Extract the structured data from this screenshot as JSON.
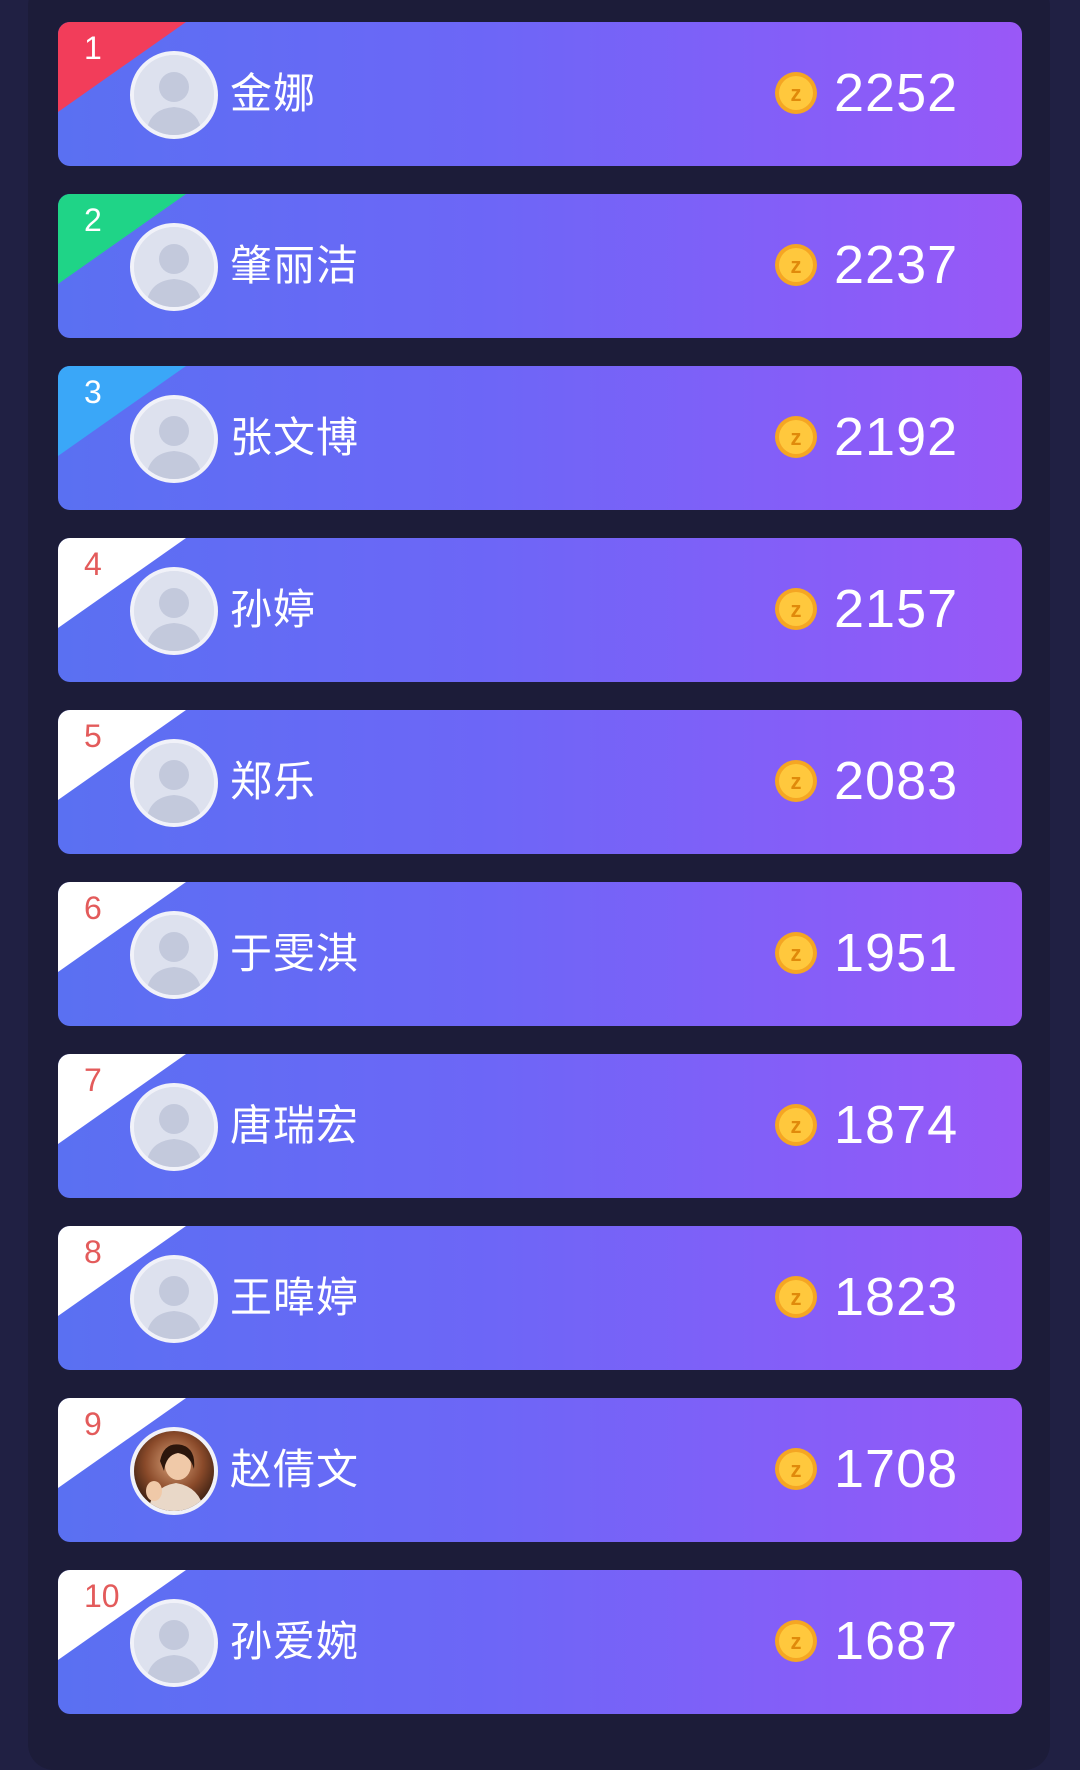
{
  "colors": {
    "background": "#202043",
    "row_gradient_start": "#5a70f2",
    "row_gradient_end": "#9a58f7",
    "rank1": "#f23d5a",
    "rank2": "#1fd487",
    "rank3": "#3aa7f8",
    "rank_other_bg": "#ffffff",
    "rank_other_text": "#e35b5b",
    "coin": "#f7b731"
  },
  "coin_icon": "gold-z-coin-icon",
  "leaderboard": [
    {
      "rank": "1",
      "name": "金娜",
      "score": "2252",
      "avatar": "default-avatar"
    },
    {
      "rank": "2",
      "name": "肇丽洁",
      "score": "2237",
      "avatar": "default-avatar"
    },
    {
      "rank": "3",
      "name": "张文博",
      "score": "2192",
      "avatar": "default-avatar"
    },
    {
      "rank": "4",
      "name": "孙婷",
      "score": "2157",
      "avatar": "default-avatar"
    },
    {
      "rank": "5",
      "name": "郑乐",
      "score": "2083",
      "avatar": "default-avatar"
    },
    {
      "rank": "6",
      "name": "于雯淇",
      "score": "1951",
      "avatar": "default-avatar"
    },
    {
      "rank": "7",
      "name": "唐瑞宏",
      "score": "1874",
      "avatar": "default-avatar"
    },
    {
      "rank": "8",
      "name": "王暐婷",
      "score": "1823",
      "avatar": "default-avatar"
    },
    {
      "rank": "9",
      "name": "赵倩文",
      "score": "1708",
      "avatar": "photo-avatar"
    },
    {
      "rank": "10",
      "name": "孙爱婉",
      "score": "1687",
      "avatar": "default-avatar"
    }
  ]
}
